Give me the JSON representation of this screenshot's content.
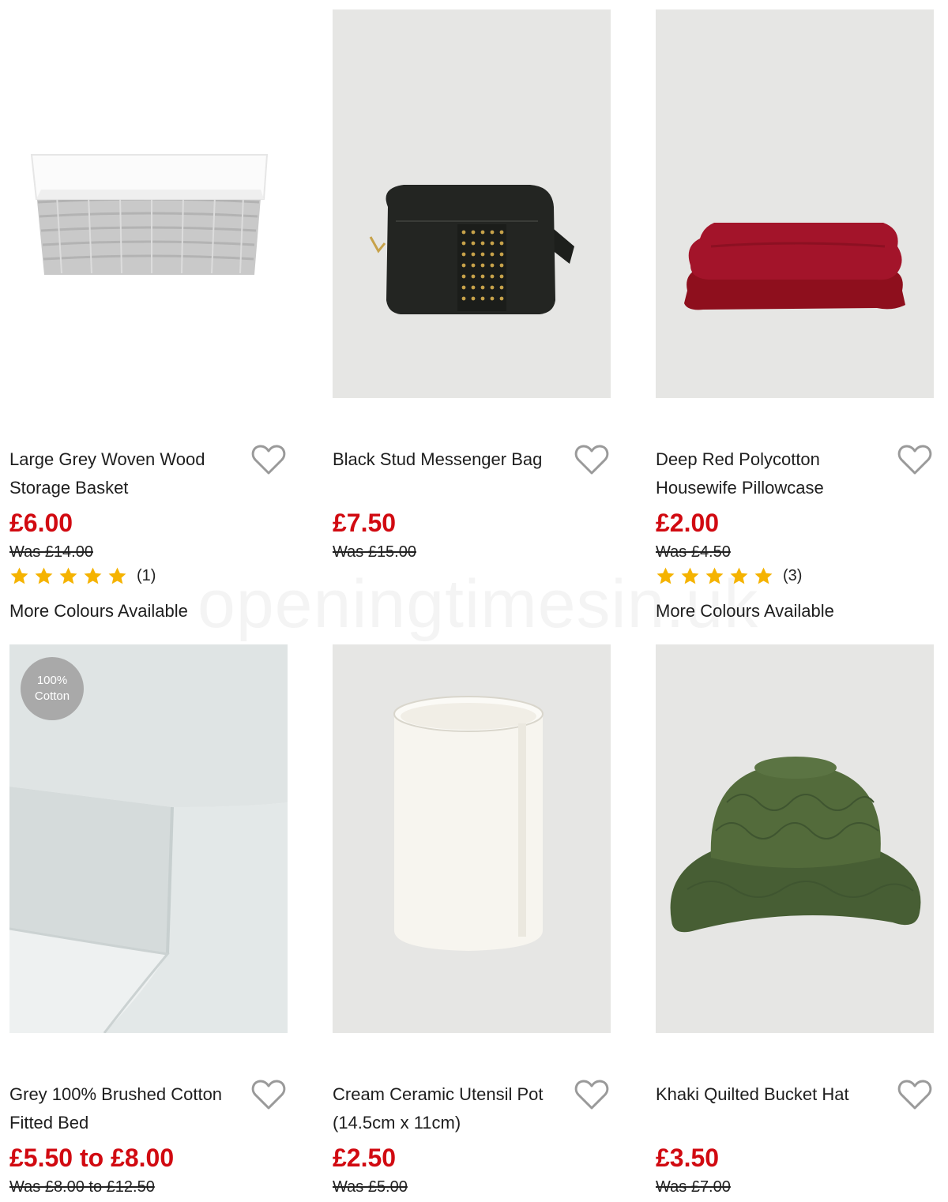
{
  "products": [
    {
      "title": "Large Grey Woven Wood Storage Basket",
      "price": "£6.00",
      "was": "Was £14.00",
      "rating_count": "(1)",
      "rating": 5,
      "more": "More Colours Available"
    },
    {
      "title": "Black Stud Messenger Bag",
      "price": "£7.50",
      "was": "Was £15.00"
    },
    {
      "title": "Deep Red Polycotton Housewife Pillowcase",
      "price": "£2.00",
      "was": "Was £4.50",
      "rating_count": "(3)",
      "rating": 5,
      "more": "More Colours Available"
    },
    {
      "title": "Grey 100% Brushed Cotton Fitted Bed",
      "price": "£5.50 to £8.00",
      "was": "Was £8.00 to £12.50",
      "badge_line1": "100%",
      "badge_line2": "Cotton"
    },
    {
      "title": "Cream Ceramic Utensil Pot (14.5cm x 11cm)",
      "price": "£2.50",
      "was": "Was £5.00"
    },
    {
      "title": "Khaki Quilted Bucket Hat",
      "price": "£3.50",
      "was": "Was £7.00"
    }
  ],
  "watermark": "openingtimesin.uk",
  "icons": {
    "wishlist": "heart-outline-icon",
    "rating": "star-icon"
  },
  "colors": {
    "price": "#d10a11",
    "star": "#f5b301",
    "heart": "#9a9a9a"
  }
}
